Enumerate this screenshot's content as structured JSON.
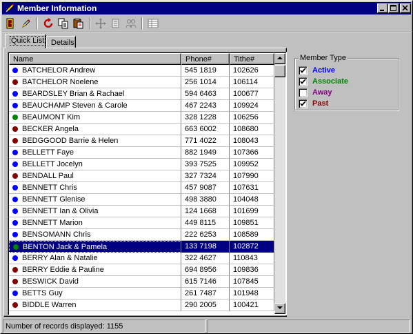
{
  "window": {
    "title": "Member Information"
  },
  "toolbar": {
    "icons": [
      "door-exit-icon",
      "edit-pen-icon",
      "refresh-icon",
      "copy-icon",
      "paste-icon",
      "move-icon",
      "document-icon",
      "people-icon",
      "grid-icon"
    ]
  },
  "tabs": [
    {
      "label": "Quick List",
      "active": true
    },
    {
      "label": "Details",
      "active": false
    }
  ],
  "grid": {
    "columns": [
      "Name",
      "Phone#",
      "Tithe#"
    ],
    "rows": [
      {
        "name": "BATCHELOR Andrew",
        "phone": "545 1819",
        "tithe": "102626",
        "type": "Active"
      },
      {
        "name": "BATCHELOR Noelene",
        "phone": "256 1014",
        "tithe": "106114",
        "type": "Past"
      },
      {
        "name": "BEARDSLEY Brian & Rachael",
        "phone": "594 6463",
        "tithe": "100677",
        "type": "Active"
      },
      {
        "name": "BEAUCHAMP Steven & Carole",
        "phone": "467 2243",
        "tithe": "109924",
        "type": "Active"
      },
      {
        "name": "BEAUMONT Kim",
        "phone": "328 1228",
        "tithe": "106256",
        "type": "Associate"
      },
      {
        "name": "BECKER Angela",
        "phone": "663 6002",
        "tithe": "108680",
        "type": "Past"
      },
      {
        "name": "BEDGGOOD Barrie & Helen",
        "phone": "771 4022",
        "tithe": "108043",
        "type": "Past"
      },
      {
        "name": "BELLETT Faye",
        "phone": "882 1949",
        "tithe": "107366",
        "type": "Active"
      },
      {
        "name": "BELLETT Jocelyn",
        "phone": "393 7525",
        "tithe": "109952",
        "type": "Active"
      },
      {
        "name": "BENDALL Paul",
        "phone": "327 7324",
        "tithe": "107990",
        "type": "Past"
      },
      {
        "name": "BENNETT Chris",
        "phone": "457 9087",
        "tithe": "107631",
        "type": "Active"
      },
      {
        "name": "BENNETT Glenise",
        "phone": "498 3880",
        "tithe": "104048",
        "type": "Active"
      },
      {
        "name": "BENNETT Ian & Olivia",
        "phone": "124 1668",
        "tithe": "101699",
        "type": "Active"
      },
      {
        "name": "BENNETT Marion",
        "phone": "449 8115",
        "tithe": "109851",
        "type": "Active"
      },
      {
        "name": "BENSOMANN Chris",
        "phone": "222 6253",
        "tithe": "108589",
        "type": "Active"
      },
      {
        "name": "BENTON Jack & Pamela",
        "phone": "133 7198",
        "tithe": "102872",
        "type": "Associate",
        "selected": true
      },
      {
        "name": "BERRY Alan & Natalie",
        "phone": "322 4627",
        "tithe": "110843",
        "type": "Active"
      },
      {
        "name": "BERRY Eddie & Pauline",
        "phone": "694 8956",
        "tithe": "109836",
        "type": "Past"
      },
      {
        "name": "BESWICK David",
        "phone": "615 7146",
        "tithe": "107845",
        "type": "Past"
      },
      {
        "name": "BETTS Guy",
        "phone": "261 7487",
        "tithe": "101948",
        "type": "Active"
      },
      {
        "name": "BIDDLE Warren",
        "phone": "290 2005",
        "tithe": "100421",
        "type": "Past"
      }
    ]
  },
  "member_type": {
    "title": "Member Type",
    "items": [
      {
        "label": "Active",
        "checked": true,
        "color": "#0000ff"
      },
      {
        "label": "Associate",
        "checked": true,
        "color": "#008000"
      },
      {
        "label": "Away",
        "checked": false,
        "color": "#800080"
      },
      {
        "label": "Past",
        "checked": true,
        "color": "#800000"
      }
    ]
  },
  "type_colors": {
    "Active": "#0000ff",
    "Associate": "#008000",
    "Away": "#800080",
    "Past": "#800000"
  },
  "status": {
    "records": "Number of records displayed: 1155",
    "secondary": ""
  }
}
